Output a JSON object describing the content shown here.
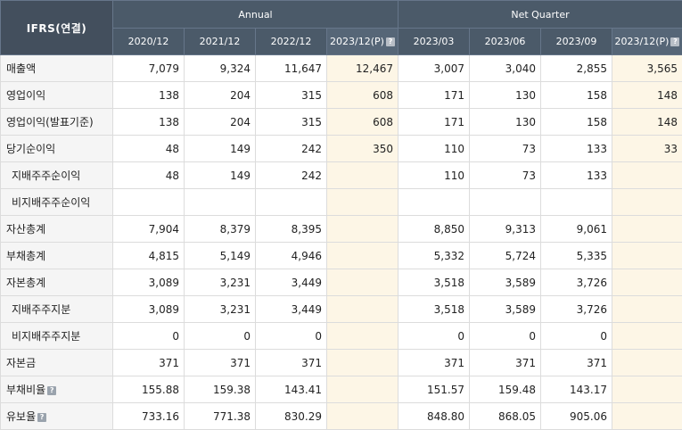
{
  "table": {
    "corner_label": "IFRS(연결)",
    "groups": [
      {
        "label": "Annual"
      },
      {
        "label": "Net Quarter"
      }
    ],
    "annual_columns": [
      "2020/12",
      "2021/12",
      "2022/12",
      "2023/12(P)"
    ],
    "quarter_columns": [
      "2023/03",
      "2023/06",
      "2023/09",
      "2023/12(P)"
    ],
    "rows": [
      {
        "label": "매출액",
        "indent": false,
        "help": false,
        "values": [
          "7,079",
          "9,324",
          "11,647",
          "12,467",
          "3,007",
          "3,040",
          "2,855",
          "3,565"
        ]
      },
      {
        "label": "영업이익",
        "indent": false,
        "help": false,
        "values": [
          "138",
          "204",
          "315",
          "608",
          "171",
          "130",
          "158",
          "148"
        ]
      },
      {
        "label": "영업이익(발표기준)",
        "indent": false,
        "help": false,
        "values": [
          "138",
          "204",
          "315",
          "608",
          "171",
          "130",
          "158",
          "148"
        ]
      },
      {
        "label": "당기순이익",
        "indent": false,
        "help": false,
        "values": [
          "48",
          "149",
          "242",
          "350",
          "110",
          "73",
          "133",
          "33"
        ]
      },
      {
        "label": "지배주주순이익",
        "indent": true,
        "help": false,
        "values": [
          "48",
          "149",
          "242",
          "",
          "110",
          "73",
          "133",
          ""
        ]
      },
      {
        "label": "비지배주주순이익",
        "indent": true,
        "help": false,
        "values": [
          "",
          "",
          "",
          "",
          "",
          "",
          "",
          ""
        ]
      },
      {
        "label": "자산총계",
        "indent": false,
        "help": false,
        "values": [
          "7,904",
          "8,379",
          "8,395",
          "",
          "8,850",
          "9,313",
          "9,061",
          ""
        ]
      },
      {
        "label": "부채총계",
        "indent": false,
        "help": false,
        "values": [
          "4,815",
          "5,149",
          "4,946",
          "",
          "5,332",
          "5,724",
          "5,335",
          ""
        ]
      },
      {
        "label": "자본총계",
        "indent": false,
        "help": false,
        "values": [
          "3,089",
          "3,231",
          "3,449",
          "",
          "3,518",
          "3,589",
          "3,726",
          ""
        ]
      },
      {
        "label": "지배주주지분",
        "indent": true,
        "help": false,
        "values": [
          "3,089",
          "3,231",
          "3,449",
          "",
          "3,518",
          "3,589",
          "3,726",
          ""
        ]
      },
      {
        "label": "비지배주주지분",
        "indent": true,
        "help": false,
        "values": [
          "0",
          "0",
          "0",
          "",
          "0",
          "0",
          "0",
          ""
        ]
      },
      {
        "label": "자본금",
        "indent": false,
        "help": false,
        "values": [
          "371",
          "371",
          "371",
          "",
          "371",
          "371",
          "371",
          ""
        ]
      },
      {
        "label": "부채비율",
        "indent": false,
        "help": true,
        "values": [
          "155.88",
          "159.38",
          "143.41",
          "",
          "151.57",
          "159.48",
          "143.17",
          ""
        ]
      },
      {
        "label": "유보율",
        "indent": false,
        "help": true,
        "values": [
          "733.16",
          "771.38",
          "830.29",
          "",
          "848.80",
          "868.05",
          "905.06",
          ""
        ]
      }
    ]
  },
  "colors": {
    "header_bg": "#4b5a69",
    "header_corner_bg": "#434f5d",
    "label_bg": "#f5f5f5",
    "estimate_bg": "#fdf6e6",
    "border": "#dcdcdc"
  },
  "icons": {
    "help": "question-mark-icon",
    "help_glyph": "?"
  }
}
